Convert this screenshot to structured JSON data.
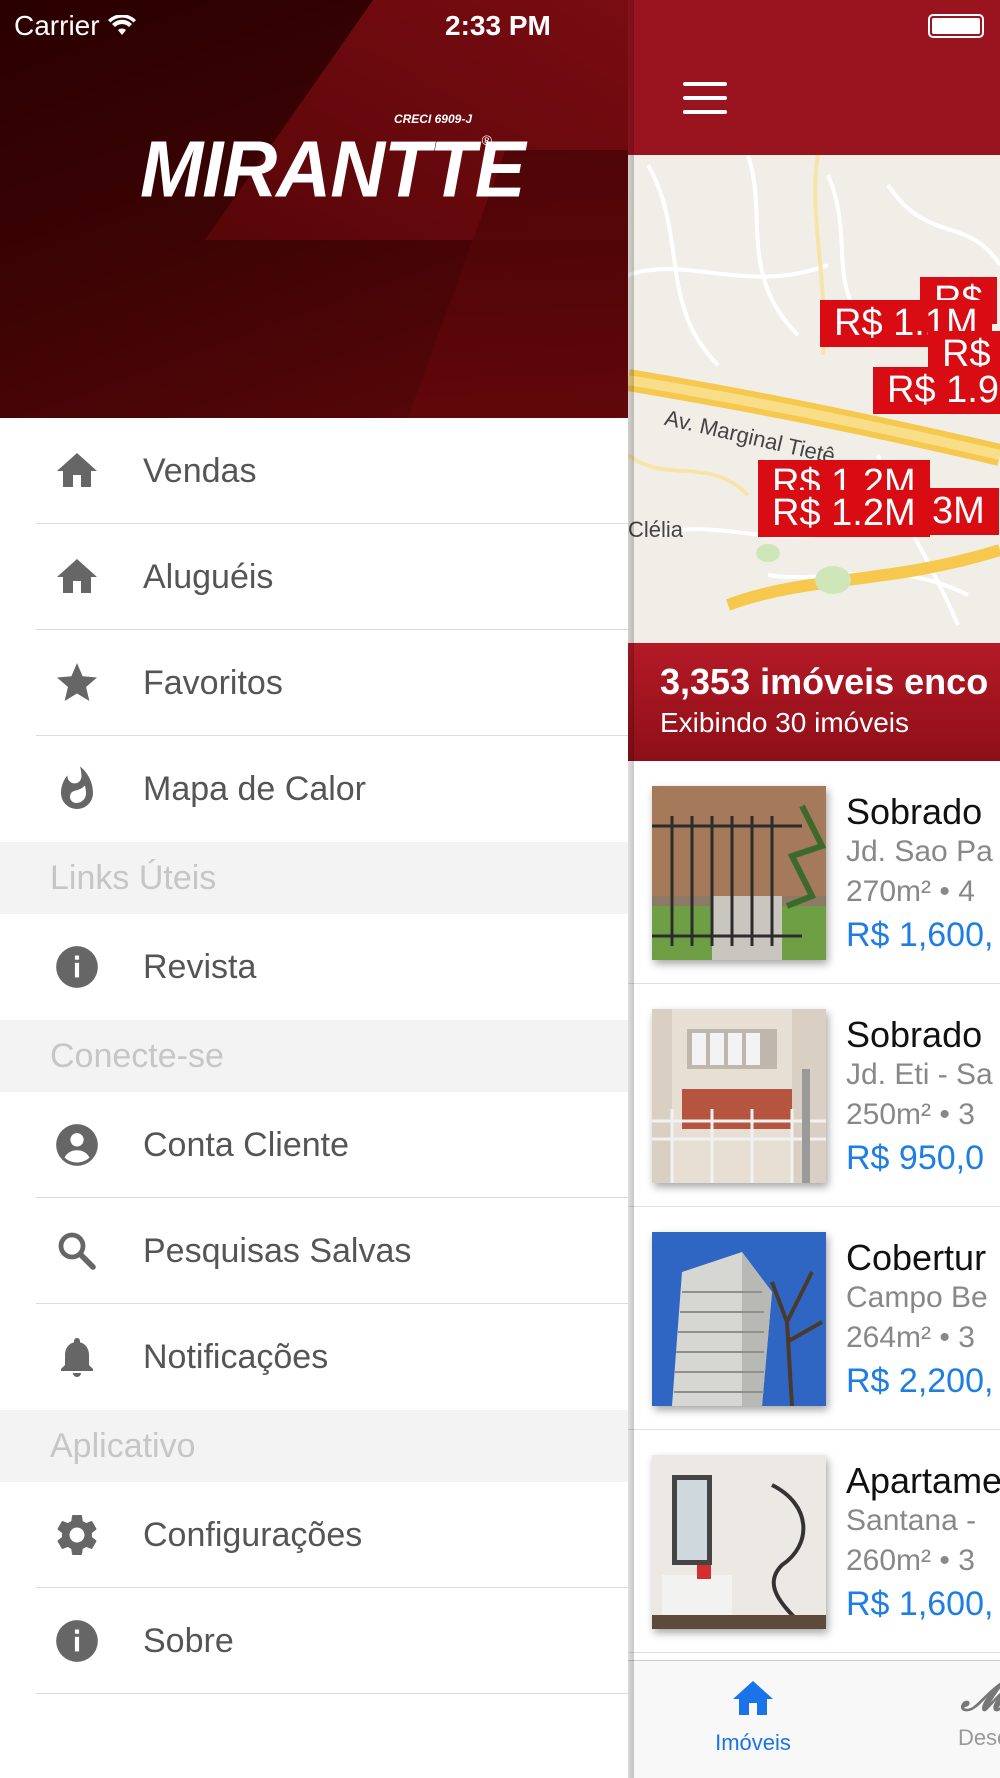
{
  "status_bar": {
    "carrier": "Carrier",
    "time": "2:33 PM"
  },
  "drawer": {
    "logo": {
      "creci": "CRECI 6909-J",
      "name": "MIRANTTE",
      "registered": "®"
    },
    "items": [
      {
        "label": "Vendas",
        "icon": "home-icon"
      },
      {
        "label": "Aluguéis",
        "icon": "home-icon"
      },
      {
        "label": "Favoritos",
        "icon": "star-icon"
      },
      {
        "label": "Mapa de Calor",
        "icon": "flame-icon"
      }
    ],
    "sections": [
      {
        "title": "Links Úteis",
        "items": [
          {
            "label": "Revista",
            "icon": "info-icon"
          }
        ]
      },
      {
        "title": "Conecte-se",
        "items": [
          {
            "label": "Conta Cliente",
            "icon": "account-icon"
          },
          {
            "label": "Pesquisas Salvas",
            "icon": "search-icon"
          },
          {
            "label": "Notificações",
            "icon": "bell-icon"
          }
        ]
      },
      {
        "title": "Aplicativo",
        "items": [
          {
            "label": "Configurações",
            "icon": "gear-icon"
          },
          {
            "label": "Sobre",
            "icon": "info-icon"
          }
        ]
      }
    ]
  },
  "main": {
    "map": {
      "street_labels": [
        "Av. Marginal Tietê",
        "Clélia"
      ],
      "price_markers": [
        "R$",
        "R$ 1.1M",
        "R$",
        "R$ 1.9",
        "R$ 1.2M",
        "R$ 1.2M",
        "3M"
      ]
    },
    "results": {
      "count": "3,353 imóveis enco",
      "showing": "Exibindo 30 imóveis"
    },
    "listings": [
      {
        "title": "Sobrado",
        "location": "Jd. Sao Pa",
        "area": "270m² • 4",
        "price": "R$ 1,600,"
      },
      {
        "title": "Sobrado",
        "location": "Jd. Eti - Sa",
        "area": "250m² • 3",
        "price": "R$ 950,0"
      },
      {
        "title": "Cobertur",
        "location": "Campo Be",
        "area": "264m² • 3",
        "price": "R$ 2,200,"
      },
      {
        "title": "Apartame",
        "location": "Santana -",
        "area": "260m² • 3",
        "price": "R$ 1,600,"
      }
    ],
    "tabs": [
      {
        "label": "Imóveis",
        "icon": "home-icon"
      },
      {
        "label": "Desc",
        "icon": "brand-icon"
      }
    ]
  },
  "colors": {
    "brand": "#9a1420",
    "marker": "#d80c12",
    "price": "#1e7ee4",
    "tab_active": "#1a73e8"
  }
}
